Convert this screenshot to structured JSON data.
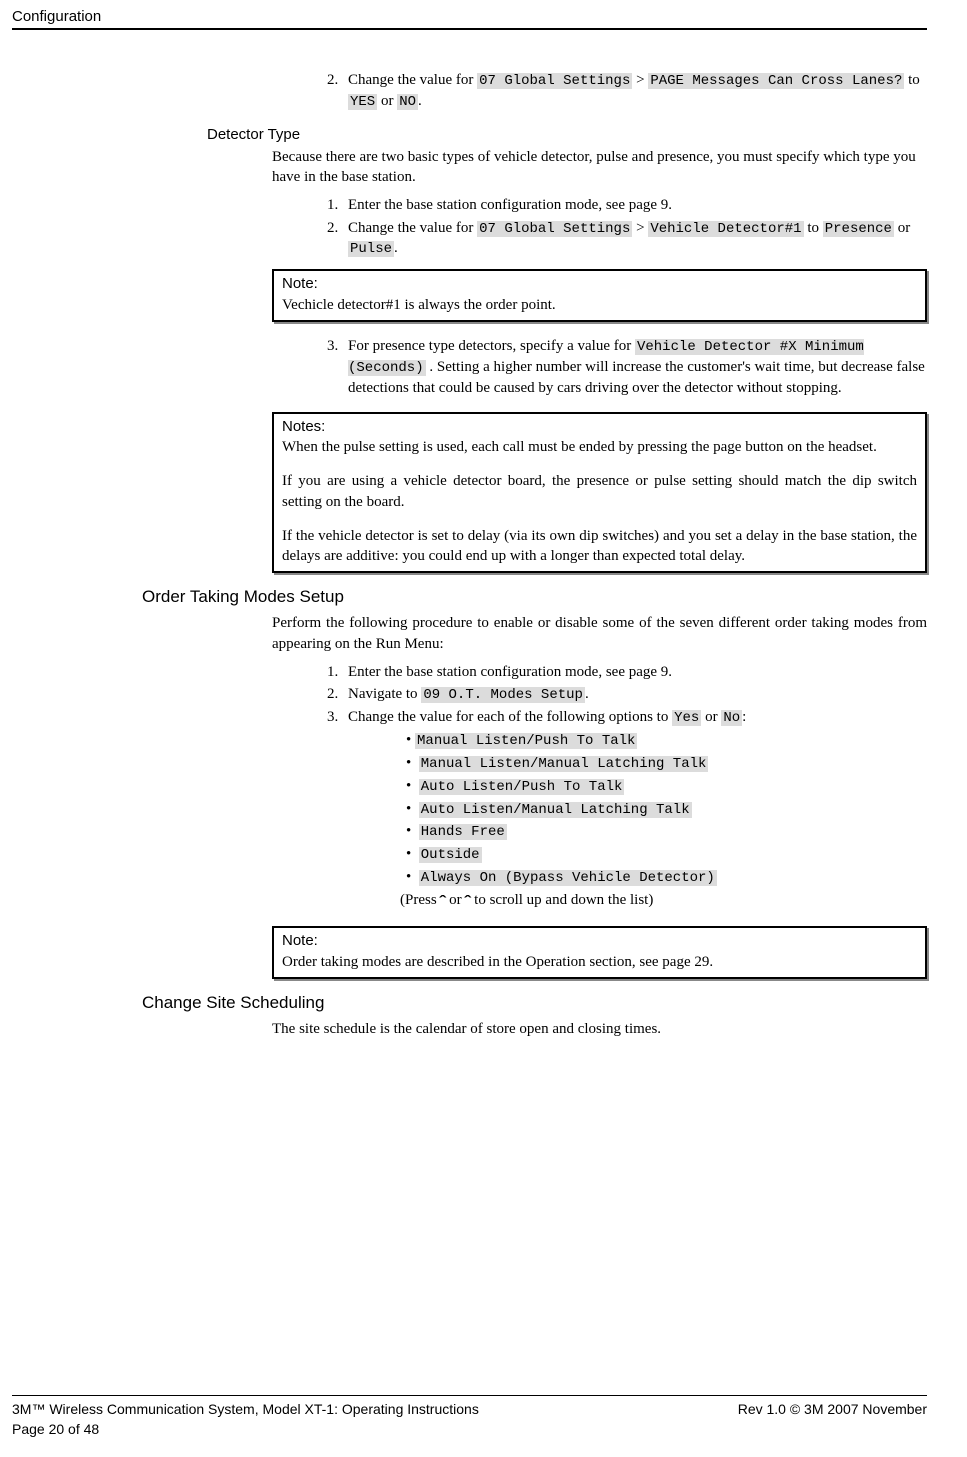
{
  "header": {
    "title": "Configuration"
  },
  "top_list": {
    "item2_pre": "Change the value for ",
    "item2_code1": "07 Global Settings",
    "item2_gt": " > ",
    "item2_code2": "PAGE Messages Can Cross Lanes?",
    "item2_mid": " to ",
    "item2_code3": "YES",
    "item2_or": " or ",
    "item2_code4": "NO",
    "item2_end": "."
  },
  "detector": {
    "heading": "Detector Type",
    "intro": "Because there are two basic types of vehicle detector, pulse and presence, you must specify which type you have in the base station.",
    "li1": "Enter the base station configuration mode, see page 9.",
    "li2_pre": "Change the value for ",
    "li2_code1": "07 Global Settings",
    "li2_gt": " > ",
    "li2_code2": "Vehicle Detector#1",
    "li2_mid": " to ",
    "li2_code3": "Presence",
    "li2_or": " or ",
    "li2_code4": "Pulse",
    "li2_end": ".",
    "note1_label": "Note:",
    "note1_body": "Vechicle detector#1 is always the order point.",
    "li3_pre": "For presence type detectors, specify a value for  ",
    "li3_code1": "Vehicle Detector #X Minimum (Seconds)",
    "li3_post": " .  Setting a higher number will increase the customer's wait time, but decrease false detections that could be caused by cars driving over the detector without stopping.",
    "note2_label": "Notes:",
    "note2_p1": "When the pulse setting is used, each call must be ended by pressing the page button on the headset.",
    "note2_p2": "If you are using a vehicle detector board, the presence or pulse setting should match the dip switch setting on the board.",
    "note2_p3": "If the vehicle detector is set to delay (via its own dip switches) and you set a delay in the base station, the delays are additive: you could end up with a longer than expected total delay."
  },
  "order": {
    "heading": "Order Taking Modes Setup",
    "intro": "Perform the following procedure to enable or disable some of the seven different order taking modes from appearing on the Run Menu:",
    "li1": "Enter the base station configuration mode, see page 9.",
    "li2_pre": "Navigate to ",
    "li2_code": "09 O.T.   Modes Setup",
    "li2_end": ".",
    "li3_pre": "Change the value for each of the following options to ",
    "li3_code1": "Yes",
    "li3_or": " or ",
    "li3_code2": "No",
    "li3_end": ":",
    "bullets": {
      "b1": "Manual Listen/Push To Talk",
      "b2": "Manual Listen/Manual Latching Talk",
      "b3": "Auto Listen/Push To Talk",
      "b4": "Auto Listen/Manual Latching Talk",
      "b5": "Hands Free",
      "b6": "Outside",
      "b7": "Always On  (Bypass Vehicle Detector)"
    },
    "press_pre": "(Press ",
    "press_mid": " or ",
    "press_end": " to scroll up and down the list)",
    "note_label": "Note:",
    "note_body": "Order taking modes are described in the Operation section, see page 29."
  },
  "sched": {
    "heading": "Change Site Scheduling",
    "intro": "The site schedule is the calendar of store open and closing times."
  },
  "footer": {
    "left": "3M™ Wireless Communication System, Model XT-1: Operating Instructions",
    "right": "Rev 1.0 © 3M 2007 November",
    "page": "Page 20 of 48"
  }
}
